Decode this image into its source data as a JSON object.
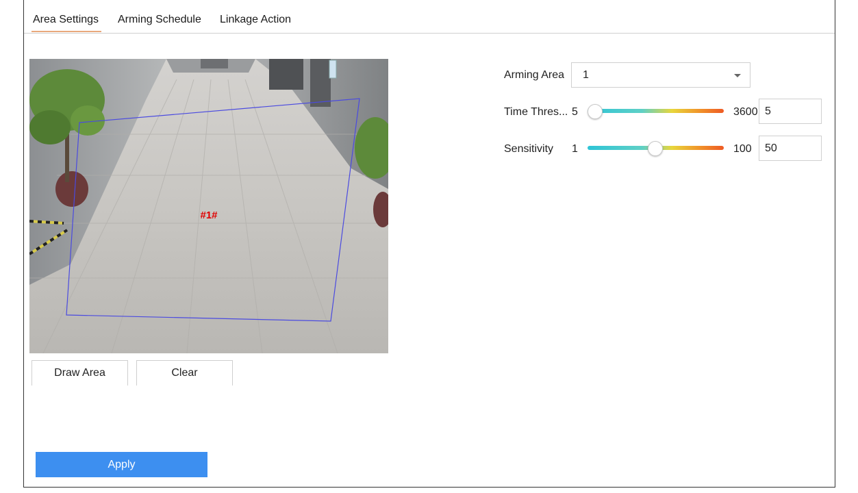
{
  "tabs": [
    {
      "label": "Area Settings",
      "active": true
    },
    {
      "label": "Arming Schedule",
      "active": false
    },
    {
      "label": "Linkage Action",
      "active": false
    }
  ],
  "preview": {
    "region_label": "#1#",
    "region_color": "#4a4ae0",
    "label_color": "#e00000"
  },
  "buttons": {
    "draw_area": "Draw Area",
    "clear": "Clear",
    "apply": "Apply"
  },
  "settings": {
    "arming_area": {
      "label": "Arming Area",
      "value": "1"
    },
    "time_threshold": {
      "label": "Time Thres...",
      "min": "5",
      "max": "3600",
      "value": "5",
      "fraction": 0.0
    },
    "sensitivity": {
      "label": "Sensitivity",
      "min": "1",
      "max": "100",
      "value": "50",
      "fraction": 0.495
    }
  },
  "colors": {
    "accent": "#3d8ff0",
    "tab_underline": "#e8a87c"
  }
}
